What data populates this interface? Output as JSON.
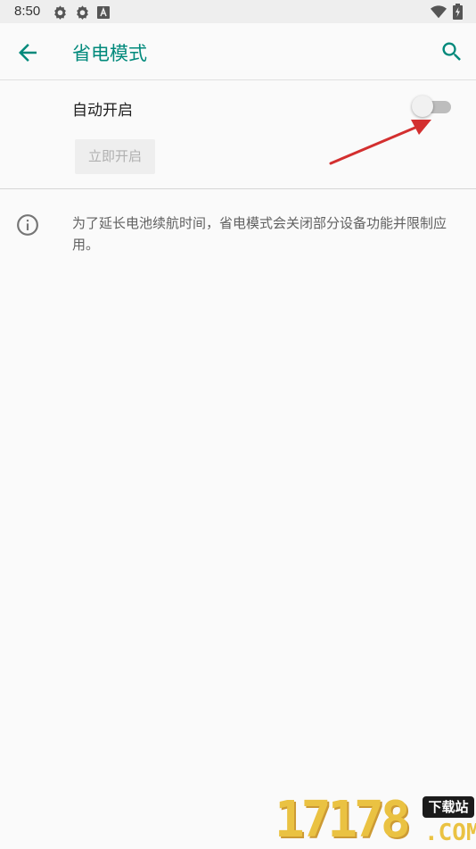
{
  "status_bar": {
    "time": "8:50"
  },
  "app_bar": {
    "title": "省电模式"
  },
  "auto_on": {
    "label": "自动开启",
    "enabled": false
  },
  "turn_on_now": {
    "label": "立即开启",
    "enabled": false
  },
  "info": {
    "text": "为了延长电池续航时间，省电模式会关闭部分设备功能并限制应用。"
  },
  "watermark": {
    "digits": "17178",
    "badge": "下载站",
    "suffix": ".COM"
  },
  "colors": {
    "accent": "#00897b",
    "annotation_arrow": "#d32f2f"
  },
  "icons": [
    "settings-icon",
    "android-icon",
    "a-notification-icon",
    "wifi-icon",
    "battery-charging-icon",
    "back-arrow-icon",
    "search-icon",
    "info-icon"
  ]
}
